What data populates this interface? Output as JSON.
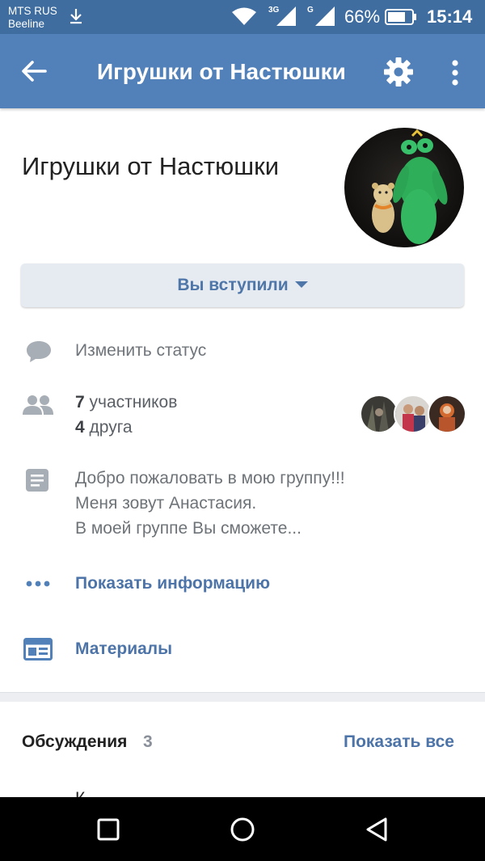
{
  "status_bar": {
    "carrier_line1": "MTS RUS",
    "carrier_line2": "Beeline",
    "net1": "3G",
    "net2": "G",
    "battery": "66%",
    "time": "15:14"
  },
  "toolbar": {
    "title": "Игрушки от Настюшки"
  },
  "group": {
    "name": "Игрушки от Настюшки",
    "join_state": "Вы вступили"
  },
  "rows": {
    "status": "Изменить статус",
    "members_count": "7",
    "members_label": "участников",
    "friends_count": "4",
    "friends_label": "друга",
    "desc_line1": "Добро пожаловать в мою группу!!!",
    "desc_line2": "Меня зовут Анастасия.",
    "desc_line3": "В моей группе Вы сможете...",
    "show_info": "Показать информацию",
    "materials": "Материалы"
  },
  "discussions": {
    "title": "Обсуждения",
    "count": "3",
    "show_all": "Показать все",
    "partial_item": "К..."
  },
  "colors": {
    "toolbar": "#5181b8",
    "statusbar": "#3f6da0",
    "link": "#4d74a8",
    "button_bg": "#e6ebf1"
  },
  "icons": [
    "back-arrow-icon",
    "gear-icon",
    "more-vertical-icon",
    "comment-icon",
    "people-icon",
    "document-icon",
    "more-horizontal-icon",
    "materials-icon"
  ]
}
